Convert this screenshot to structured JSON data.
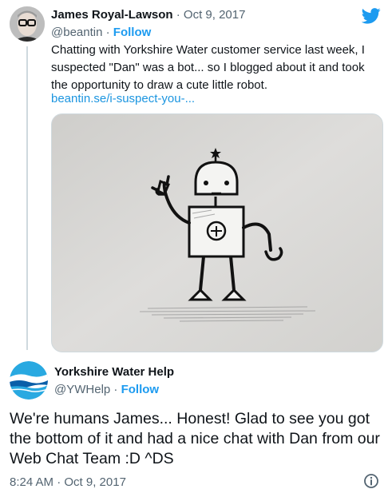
{
  "parent_tweet": {
    "author_name": "James Royal-Lawson",
    "separator": "·",
    "date": "Oct 9, 2017",
    "handle": "@beantin",
    "follow_separator": "·",
    "follow_label": "Follow",
    "text": "Chatting with Yorkshire Water customer service last week, I suspected \"Dan\" was a bot... so I blogged about it and took the opportunity to draw a cute little robot.",
    "link": "beantin.se/i-suspect-you-...",
    "platform_icon": "twitter-bird-icon"
  },
  "reply_tweet": {
    "author_name": "Yorkshire Water Help",
    "handle": "@YWHelp",
    "follow_separator": "·",
    "follow_label": "Follow",
    "text": "We're humans James... Honest! Glad to see you got the bottom of it and had a nice chat with Dan from our Web Chat Team :D ^DS",
    "timestamp": "8:24 AM · Oct 9, 2017",
    "info_icon": "info-icon"
  },
  "colors": {
    "accent": "#1d9bf0",
    "link": "#1b95e0",
    "secondary_text": "#536471",
    "primary_text": "#0f1419"
  }
}
